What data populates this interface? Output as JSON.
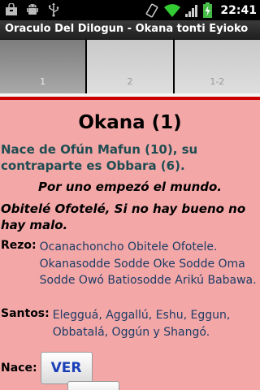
{
  "status_bar": {
    "time": "22:41",
    "icons": [
      "shopping-bag-icon",
      "android-robot-icon",
      "usb-icon",
      "rotate-icon",
      "wifi-icon",
      "signal-icon",
      "battery-charging-icon"
    ]
  },
  "title_bar": {
    "title": "Oraculo Del Dilogun - Okana tonti Eyioko"
  },
  "tabs": [
    {
      "label": "1",
      "active": true
    },
    {
      "label": "2",
      "active": false
    },
    {
      "label": "1-2",
      "active": false
    }
  ],
  "colors": {
    "accent_red": "#cc0000",
    "content_bg": "#f4a7a7",
    "teal_text": "#1f4d52",
    "value_text": "#1c3c66",
    "button_text": "#1a3fb8"
  },
  "content": {
    "heading": "Okana (1)",
    "nace_desc": "Nace de Ofún Mafun (10), su contraparte es Obbara (6).",
    "subtitle": "Por uno empezó el mundo.",
    "obitele": "Obitelé Ofotelé, Si no hay bueno no hay malo.",
    "rezo_label": "Rezo:",
    "rezo_text": "Ocanachoncho Obitele Ofotele. Okanasodde Sodde Oke Sodde Oma Sodde Owó Batiosodde Arikú Babawa.",
    "santos_label": "Santos:",
    "santos_text": "Elegguá, Aggallú, Eshu, Eggun, Obbatalá, Oggún y Shangó.",
    "nace_label": "Nace:",
    "ver_button": "VER"
  }
}
